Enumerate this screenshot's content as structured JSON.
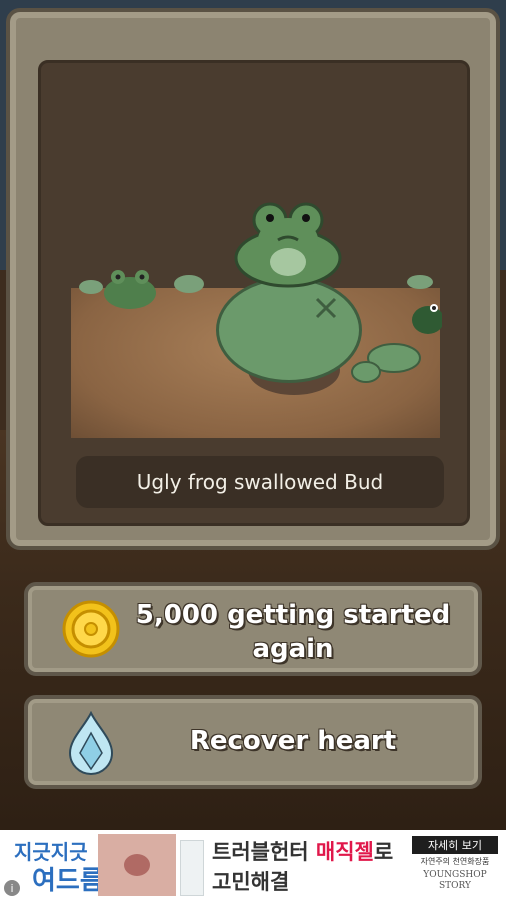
{
  "game": {
    "caption": "Ugly frog swallowed Bud",
    "restart_label_line1": "5,000 getting started",
    "restart_label_line2": "again",
    "recover_label": "Recover heart"
  },
  "ad": {
    "left_line1": "지긋지긋",
    "left_line2": "여드름",
    "mid_line1_prefix": "트러블헌터 ",
    "mid_line1_highlight": "매직젤",
    "mid_line1_suffix": "로",
    "mid_line2": "고민해결",
    "detail_button": "자세히 보기",
    "sub_text": "자연주의 천연화장품",
    "brand_line1": "YOUNGSHOP",
    "brand_line2": "STORY",
    "info": "i"
  },
  "colors": {
    "frog_green": "#5f8f5a",
    "coin_gold": "#f2c21b",
    "ad_red": "#e0174a",
    "ad_blue": "#2c6fbf"
  },
  "icons": [
    "coin-icon",
    "water-drop-icon",
    "info-icon"
  ]
}
